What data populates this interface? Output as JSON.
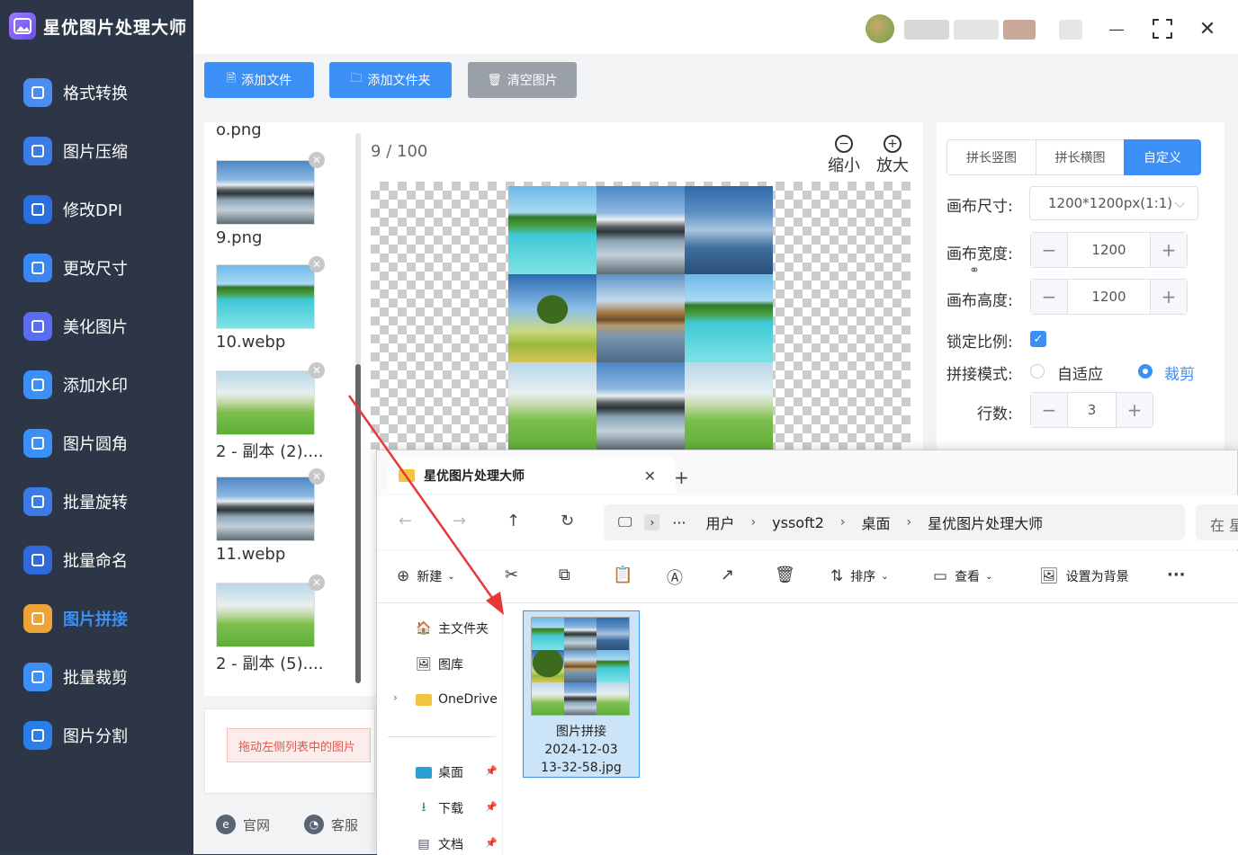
{
  "app": {
    "title": "星优图片处理大师"
  },
  "sidebar": {
    "items": [
      {
        "label": "格式转换",
        "icon": "image-convert-icon"
      },
      {
        "label": "图片压缩",
        "icon": "compress-icon"
      },
      {
        "label": "修改DPI",
        "icon": "dpi-icon"
      },
      {
        "label": "更改尺寸",
        "icon": "resize-icon"
      },
      {
        "label": "美化图片",
        "icon": "beautify-icon"
      },
      {
        "label": "添加水印",
        "icon": "watermark-icon"
      },
      {
        "label": "图片圆角",
        "icon": "rounded-corner-icon"
      },
      {
        "label": "批量旋转",
        "icon": "rotate-icon"
      },
      {
        "label": "批量命名",
        "icon": "rename-icon"
      },
      {
        "label": "图片拼接",
        "icon": "puzzle-icon",
        "active": true
      },
      {
        "label": "批量裁剪",
        "icon": "crop-icon"
      },
      {
        "label": "图片分割",
        "icon": "split-icon"
      }
    ]
  },
  "toolbar": {
    "add_file": "添加文件",
    "add_folder": "添加文件夹",
    "clear": "清空图片"
  },
  "filelist": {
    "partial": "o.png",
    "items": [
      {
        "name": "9.png",
        "img": "mtn"
      },
      {
        "name": "10.webp",
        "img": "beach"
      },
      {
        "name": "2 - 副本 (2)....",
        "img": "golf"
      },
      {
        "name": "11.webp",
        "img": "mtn"
      },
      {
        "name": "2 - 副本 (5)....",
        "img": "golf"
      }
    ]
  },
  "preview": {
    "current": "9",
    "sep": "/",
    "total": "100",
    "zoom_out": "缩小",
    "zoom_in": "放大"
  },
  "settings": {
    "modes": [
      "拼长竖图",
      "拼长横图",
      "自定义"
    ],
    "canvas_size_label": "画布尺寸:",
    "canvas_size_value": "1200*1200px(1:1)",
    "width_label": "画布宽度:",
    "width_value": "1200",
    "height_label": "画布高度:",
    "height_value": "1200",
    "lock_label": "锁定比例:",
    "mode_label": "拼接模式:",
    "mode_fit": "自适应",
    "mode_crop": "裁剪",
    "rows_label": "行数:",
    "rows_value": "3"
  },
  "hint": "拖动左侧列表中的图片",
  "footer": {
    "website": "官网",
    "service": "客服"
  },
  "explorer": {
    "tab_title": "星优图片处理大师",
    "breadcrumb": [
      "用户",
      "yssoft2",
      "桌面",
      "星优图片处理大师"
    ],
    "search_partial": "在 星",
    "commands": {
      "new": "新建",
      "sort": "排序",
      "view": "查看",
      "set_bg": "设置为背景"
    },
    "nav": {
      "home": "主文件夹",
      "gallery": "图库",
      "onedrive": "OneDrive",
      "desktop": "桌面",
      "downloads": "下载",
      "documents": "文档"
    },
    "file": {
      "line1": "图片拼接",
      "line2": "2024-12-03",
      "line3": "13-32-58.jpg"
    }
  },
  "colors": {
    "accent": "#3b8ff6",
    "sidebar_bg": "#2d3646",
    "arrow": "#e53935"
  }
}
